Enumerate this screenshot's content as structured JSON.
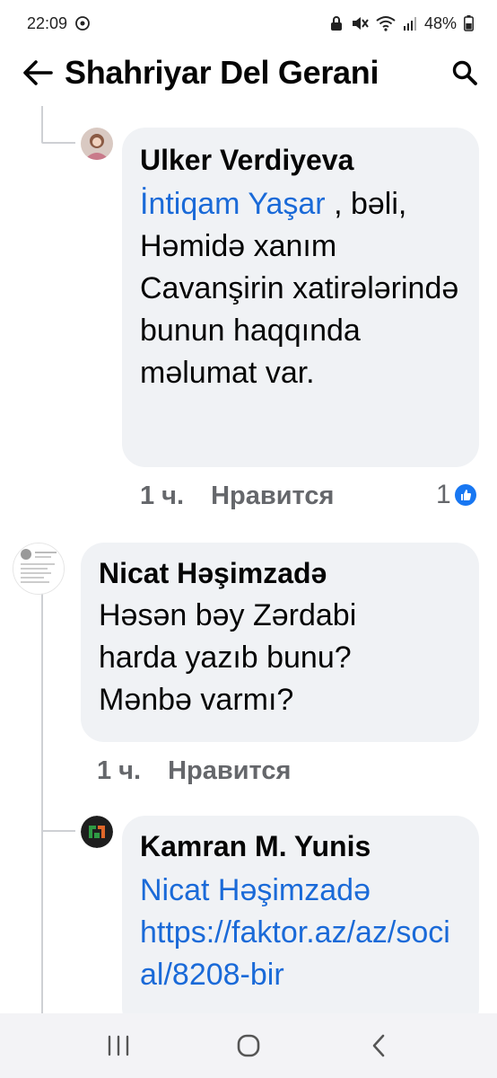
{
  "status_bar": {
    "time": "22:09",
    "battery": "48%"
  },
  "header": {
    "title": "Shahriyar Del Gerani"
  },
  "comments": [
    {
      "author": "Ulker Verdiyeva",
      "mention": "İntiqam Yaşar",
      "text": " , bəli, Həmidə xanım Cavanşirin xatirələrində bunun haqqında məlumat var.",
      "time": "1 ч.",
      "like_label": "Нравится",
      "reaction_count": "1"
    },
    {
      "author": "Nicat Həşimzadə",
      "text": "Həsən bəy Zərdabi harda yazıb bunu? Mənbə varmı?",
      "time": "1 ч.",
      "like_label": "Нравится"
    },
    {
      "author": "Kamran M. Yunis",
      "mention": "Nicat Həşimzadə",
      "link": "https://faktor.az/az/social/8208-bir"
    }
  ],
  "icons": {
    "back": "arrow-left-icon",
    "search": "search-icon",
    "like_reaction": "thumbs-up-icon",
    "nav_recents": "recents-icon",
    "nav_home": "home-icon",
    "nav_back": "back-icon"
  },
  "colors": {
    "mention": "#1a6ad8",
    "bubble": "#f0f2f5",
    "meta": "#65676b"
  }
}
